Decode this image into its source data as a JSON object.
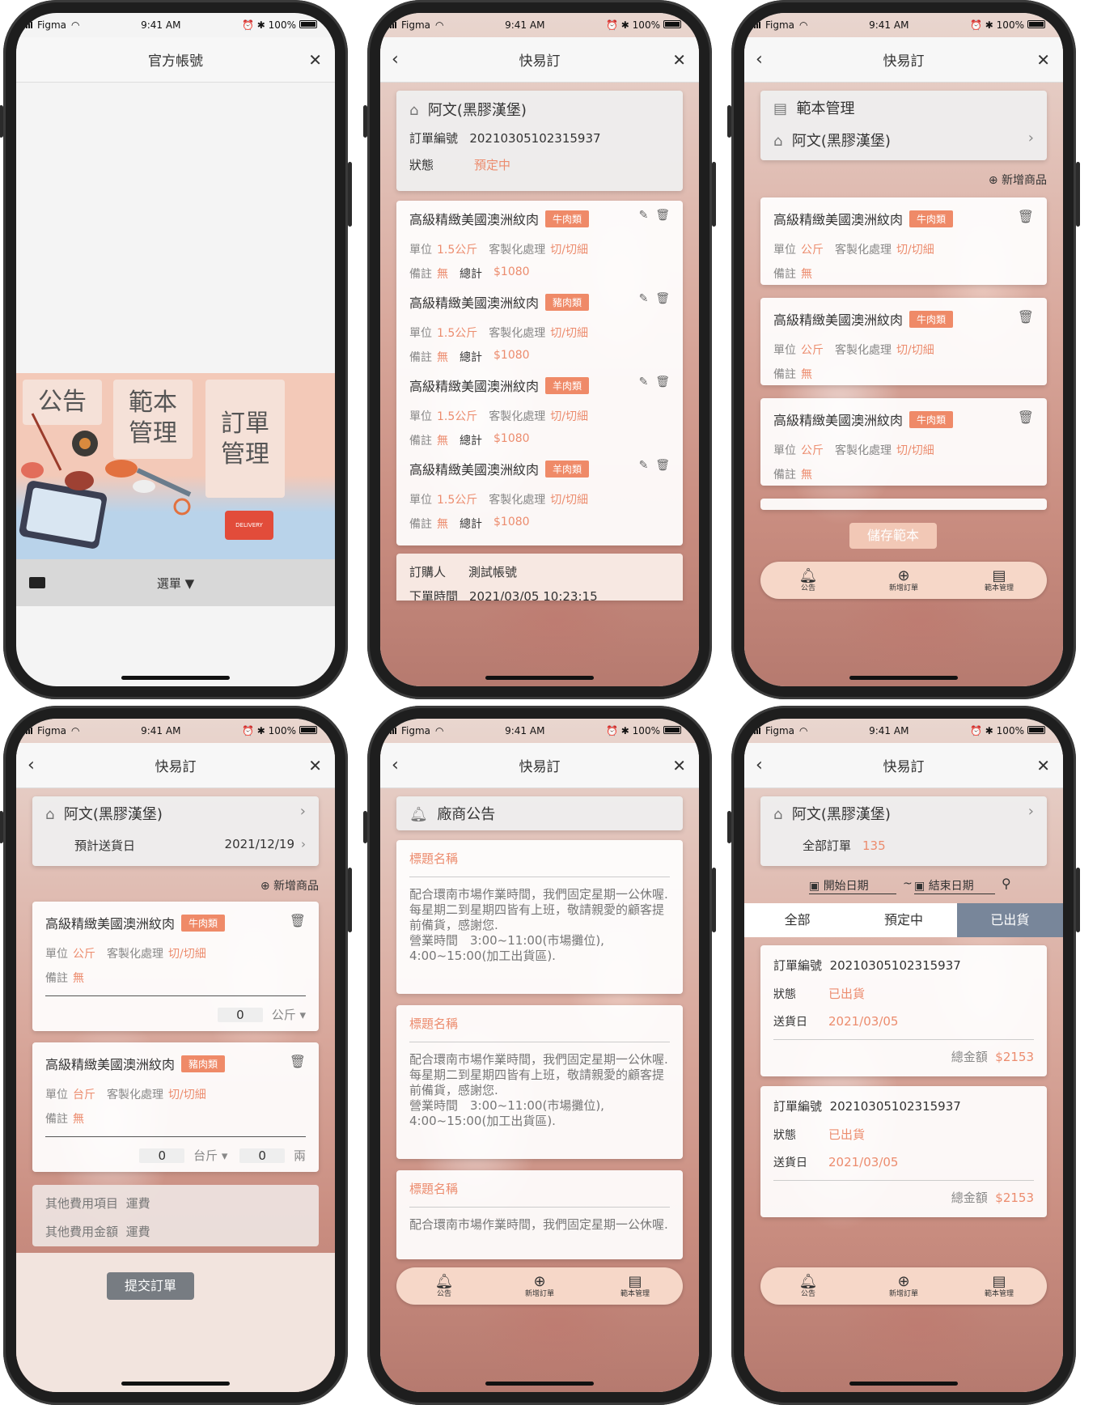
{
  "status": {
    "carrier": "Figma",
    "time": "9:41 AM",
    "battery": "100%"
  },
  "s1": {
    "title": "官方帳號",
    "tiles": [
      "公告",
      "範本\n管理",
      "訂單\n管理"
    ],
    "delivery": "DELIVERY",
    "menu_label": "選單 ▼"
  },
  "s2": {
    "title": "快易訂",
    "store": "阿文(黑膠漢堡)",
    "order_label": "訂單編號",
    "order_no": "20210305102315937",
    "state_label": "狀態",
    "state_value": "預定中",
    "items": [
      {
        "name": "高級精緻美國澳洲紋肉",
        "tag": "牛肉類",
        "unit_label": "單位",
        "unit": "1.5公斤",
        "proc_label": "客製化處理",
        "proc": "切/切細",
        "note_label": "備註",
        "note": "無",
        "total_label": "總計",
        "total": "$1080"
      },
      {
        "name": "高級精緻美國澳洲紋肉",
        "tag": "豬肉類",
        "unit_label": "單位",
        "unit": "1.5公斤",
        "proc_label": "客製化處理",
        "proc": "切/切細",
        "note_label": "備註",
        "note": "無",
        "total_label": "總計",
        "total": "$1080"
      },
      {
        "name": "高級精緻美國澳洲紋肉",
        "tag": "羊肉類",
        "unit_label": "單位",
        "unit": "1.5公斤",
        "proc_label": "客製化處理",
        "proc": "切/切細",
        "note_label": "備註",
        "note": "無",
        "total_label": "總計",
        "total": "$1080"
      },
      {
        "name": "高級精緻美國澳洲紋肉",
        "tag": "羊肉類",
        "unit_label": "單位",
        "unit": "1.5公斤",
        "proc_label": "客製化處理",
        "proc": "切/切細",
        "note_label": "備註",
        "note": "無",
        "total_label": "總計",
        "total": "$1080"
      }
    ],
    "buyer_label": "訂購人",
    "buyer": "測試帳號",
    "time_label": "下單時間",
    "time_value": "2021/03/05 10:23:15"
  },
  "s3": {
    "title": "快易訂",
    "template_mgmt": "範本管理",
    "store": "阿文(黑膠漢堡)",
    "add_item": "新增商品",
    "items": [
      {
        "name": "高級精緻美國澳洲紋肉",
        "tag": "牛肉類",
        "unit_label": "單位",
        "unit": "公斤",
        "proc_label": "客製化處理",
        "proc": "切/切細",
        "note_label": "備註",
        "note": "無"
      },
      {
        "name": "高級精緻美國澳洲紋肉",
        "tag": "牛肉類",
        "unit_label": "單位",
        "unit": "公斤",
        "proc_label": "客製化處理",
        "proc": "切/切細",
        "note_label": "備註",
        "note": "無"
      },
      {
        "name": "高級精緻美國澳洲紋肉",
        "tag": "牛肉類",
        "unit_label": "單位",
        "unit": "公斤",
        "proc_label": "客製化處理",
        "proc": "切/切細",
        "note_label": "備註",
        "note": "無"
      }
    ],
    "save_template": "儲存範本"
  },
  "tabs": {
    "announce": "公告",
    "new_order": "新增訂單",
    "template": "範本管理"
  },
  "s4": {
    "title": "快易訂",
    "store": "阿文(黑膠漢堡)",
    "delivery_label": "預計送貨日",
    "delivery_date": "2021/12/19",
    "add_item": "新增商品",
    "item1": {
      "name": "高級精緻美國澳洲紋肉",
      "tag": "牛肉類",
      "unit_label": "單位",
      "unit": "公斤",
      "proc_label": "客製化處理",
      "proc": "切/切細",
      "note_label": "備註",
      "note": "無",
      "qty": "0",
      "qty_unit": "公斤 ▾"
    },
    "item2": {
      "name": "高級精緻美國澳洲紋肉",
      "tag": "豬肉類",
      "unit_label": "單位",
      "unit": "台斤",
      "proc_label": "客製化處理",
      "proc": "切/切細",
      "note_label": "備註",
      "note": "無",
      "qty": "0",
      "qty_unit": "台斤 ▾",
      "qty2": "0",
      "qty2_unit": "兩"
    },
    "other_item_label": "其他費用項目",
    "other_item": "運費",
    "other_amount_label": "其他費用金額",
    "other_amount": "運費",
    "submit": "提交訂單"
  },
  "s5": {
    "title": "快易訂",
    "header": "廠商公告",
    "posts": [
      {
        "title": "標題名稱",
        "body": "配合環南市場作業時間，我們固定星期一公休喔.\n每星期二到星期四皆有上班，敬請親愛的顧客提前備貨，感謝您.\n營業時間　3:00~11:00(市場攤位),\n4:00~15:00(加工出貨區)."
      },
      {
        "title": "標題名稱",
        "body": "配合環南市場作業時間，我們固定星期一公休喔.\n每星期二到星期四皆有上班，敬請親愛的顧客提前備貨，感謝您.\n營業時間　3:00~11:00(市場攤位),\n4:00~15:00(加工出貨區)."
      },
      {
        "title": "標題名稱",
        "body": "配合環南市場作業時間，我們固定星期一公休喔."
      }
    ]
  },
  "s6": {
    "title": "快易訂",
    "store": "阿文(黑膠漢堡)",
    "all_orders_label": "全部訂單",
    "all_orders_count": "135",
    "start_date": "開始日期",
    "end_date": "結束日期",
    "tilde": "~",
    "filter_tabs": [
      "全部",
      "預定中",
      "已出貨"
    ],
    "orders": [
      {
        "no_label": "訂單編號",
        "no": "20210305102315937",
        "state_label": "狀態",
        "state": "已出貨",
        "date_label": "送貨日",
        "date": "2021/03/05",
        "amount_label": "總金額",
        "amount": "$2153"
      },
      {
        "no_label": "訂單編號",
        "no": "20210305102315937",
        "state_label": "狀態",
        "state": "已出貨",
        "date_label": "送貨日",
        "date": "2021/03/05",
        "amount_label": "總金額",
        "amount": "$2153"
      }
    ]
  }
}
